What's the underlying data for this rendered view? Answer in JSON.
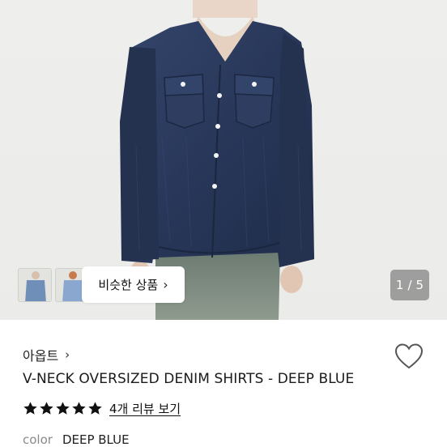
{
  "gallery": {
    "similar_button_label": "비슷한 상품",
    "current_page": "1",
    "separator": "/",
    "total_pages": "5",
    "thumbnails": [
      {
        "icon": "thumbnail-image"
      },
      {
        "icon": "thumbnail-image"
      }
    ]
  },
  "product": {
    "shop_name": "아옵트",
    "title": "V-NECK OVERSIZED DENIM SHIRTS - DEEP BLUE",
    "rating_stars": 5,
    "review_link": "4개 리뷰 보기",
    "color_label": "color",
    "color_value": "DEEP BLUE"
  },
  "colors": {
    "star": "#111111",
    "denim": "#2b3a5c",
    "background": "#ecece9"
  }
}
